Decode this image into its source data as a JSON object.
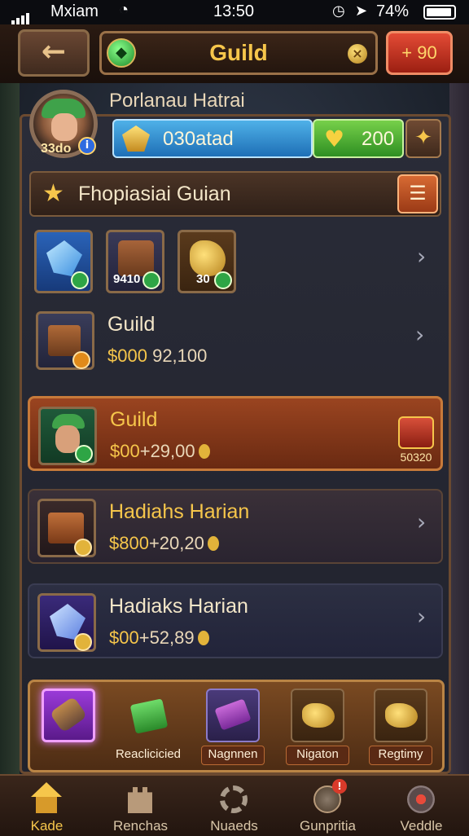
{
  "status_bar": {
    "carrier": "Mxiam",
    "time": "13:50",
    "battery": "74%"
  },
  "header": {
    "title": "Guild",
    "gold_button_label": "+ 90"
  },
  "player": {
    "name": "Porlanau Hatrai",
    "level": "33do",
    "resource_value": "030atad",
    "heart_value": "200"
  },
  "guild_section": {
    "name": "Fhopiasiai Guian"
  },
  "items": [
    {
      "name": "crystal-item",
      "count": ""
    },
    {
      "name": "chest-item",
      "count": "9410"
    },
    {
      "name": "horn-item",
      "count": "30"
    }
  ],
  "rows": [
    {
      "title": "Guild",
      "amount": "$000",
      "extra": "92,100"
    },
    {
      "title": "Guild",
      "amount": "$00",
      "extra": "+29,00",
      "badge_label": "50320"
    },
    {
      "title": "Hadiahs Harian",
      "amount": "$800",
      "extra": "+20,20"
    },
    {
      "title": "Hadiaks Harian",
      "amount": "$00",
      "extra": "+52,89"
    }
  ],
  "tray": [
    {
      "label": ""
    },
    {
      "label": "Reaclicicied"
    },
    {
      "label": "Nagnnen"
    },
    {
      "label": "Nigaton"
    },
    {
      "label": "Regtimy"
    }
  ],
  "nav": [
    {
      "label": "Kade"
    },
    {
      "label": "Renchas"
    },
    {
      "label": "Nuaeds"
    },
    {
      "label": "Gunpritia"
    },
    {
      "label": "Veddle"
    }
  ],
  "colors": {
    "accent_gold": "#f6c64b",
    "wood_brown": "#6b4a30",
    "highlight_row": "#8a3a1a",
    "panel_dark": "#262834"
  }
}
